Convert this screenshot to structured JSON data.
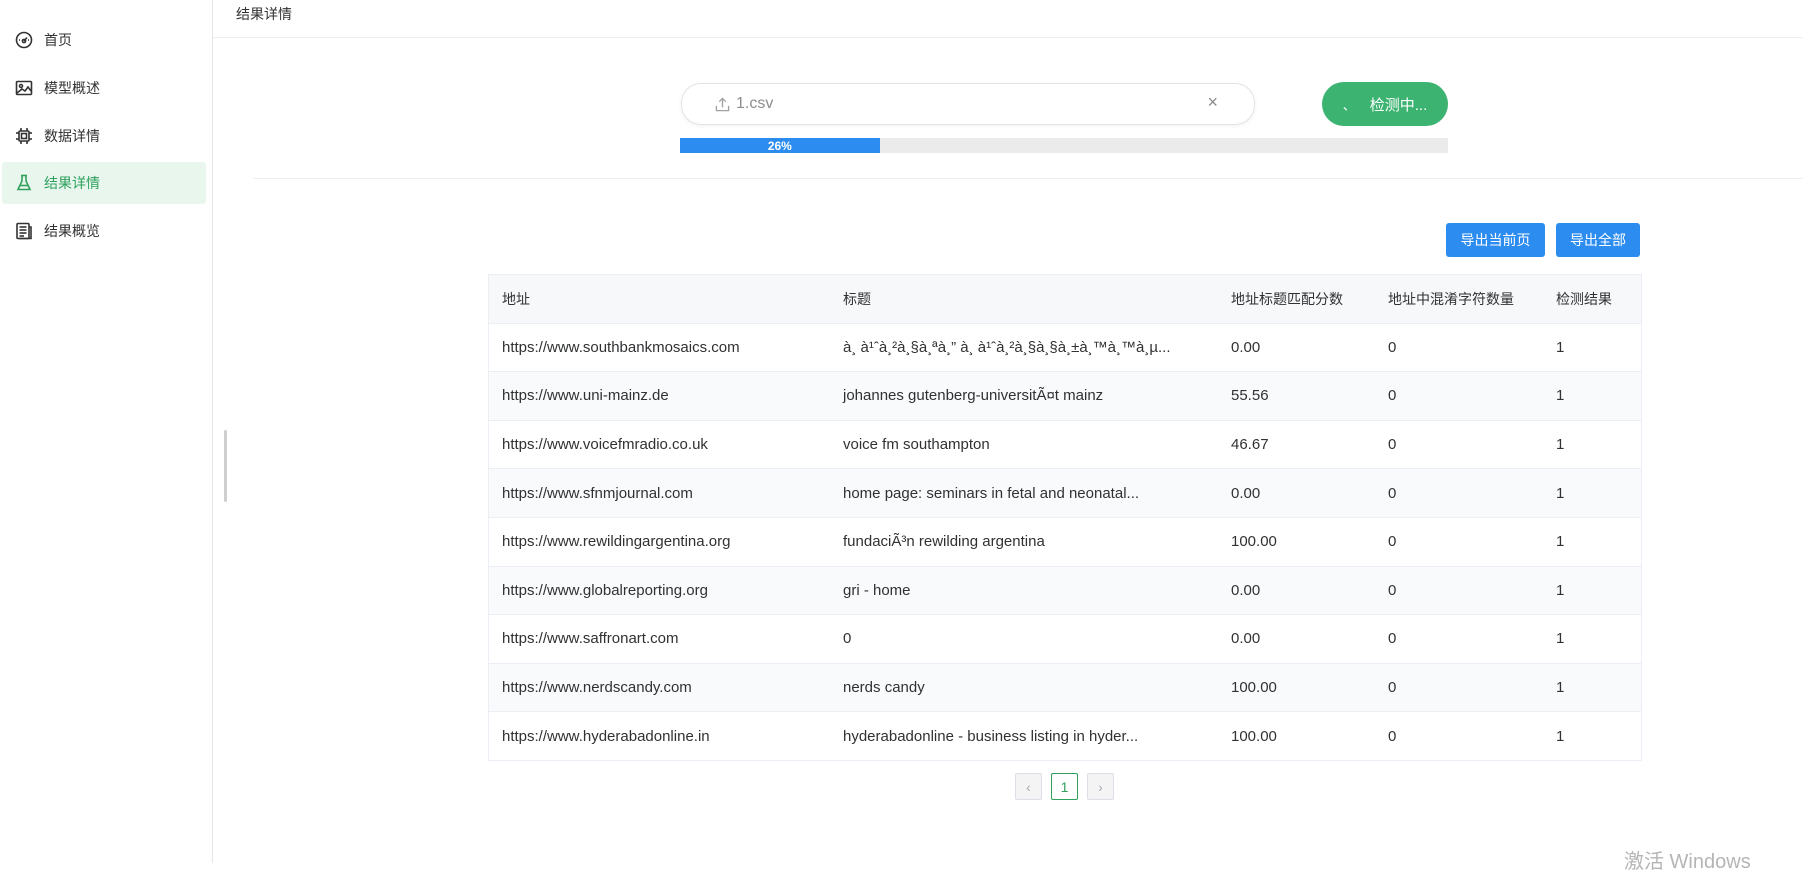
{
  "sidebar": {
    "items": [
      {
        "label": "首页",
        "icon": "dashboard-icon"
      },
      {
        "label": "模型概述",
        "icon": "image-icon"
      },
      {
        "label": "数据详情",
        "icon": "chip-icon"
      },
      {
        "label": "结果详情",
        "icon": "flask-icon",
        "active": true
      },
      {
        "label": "结果概览",
        "icon": "document-icon"
      }
    ]
  },
  "header": {
    "breadcrumb": "结果详情"
  },
  "upload": {
    "file_name": "1.csv",
    "clear_symbol": "×",
    "detect_label": "检测中...",
    "spinner": "、",
    "progress_percent": 26,
    "progress_label": "26%"
  },
  "actions": {
    "export_page": "导出当前页",
    "export_all": "导出全部"
  },
  "table": {
    "headers": [
      "地址",
      "标题",
      "地址标题匹配分数",
      "地址中混淆字符数量",
      "检测结果"
    ],
    "rows": [
      [
        "https://www.southbankmosaics.com",
        "à¸ à¹ˆà¸²à¸§à¸ªà¸” à¸ à¹ˆà¸²à¸§à¸§à¸±à¸™à¸™à¸µ...",
        "0.00",
        "0",
        "1"
      ],
      [
        "https://www.uni-mainz.de",
        "johannes gutenberg-universitÃ¤t mainz",
        "55.56",
        "0",
        "1"
      ],
      [
        "https://www.voicefmradio.co.uk",
        "voice fm southampton",
        "46.67",
        "0",
        "1"
      ],
      [
        "https://www.sfnmjournal.com",
        "home page: seminars in fetal and neonatal...",
        "0.00",
        "0",
        "1"
      ],
      [
        "https://www.rewildingargentina.org",
        "fundaciÃ³n rewilding argentina",
        "100.00",
        "0",
        "1"
      ],
      [
        "https://www.globalreporting.org",
        "gri - home",
        "0.00",
        "0",
        "1"
      ],
      [
        "https://www.saffronart.com",
        "0",
        "0.00",
        "0",
        "1"
      ],
      [
        "https://www.nerdscandy.com",
        "nerds candy",
        "100.00",
        "0",
        "1"
      ],
      [
        "https://www.hyderabadonline.in",
        "hyderabadonline - business listing in hyder...",
        "100.00",
        "0",
        "1"
      ]
    ]
  },
  "pagination": {
    "prev": "‹",
    "current": "1",
    "next": "›"
  },
  "watermark": "激活 Windows",
  "colors": {
    "accent_green": "#3cb371",
    "accent_blue": "#2d8cf0",
    "active_bg": "#e8f6ee"
  }
}
